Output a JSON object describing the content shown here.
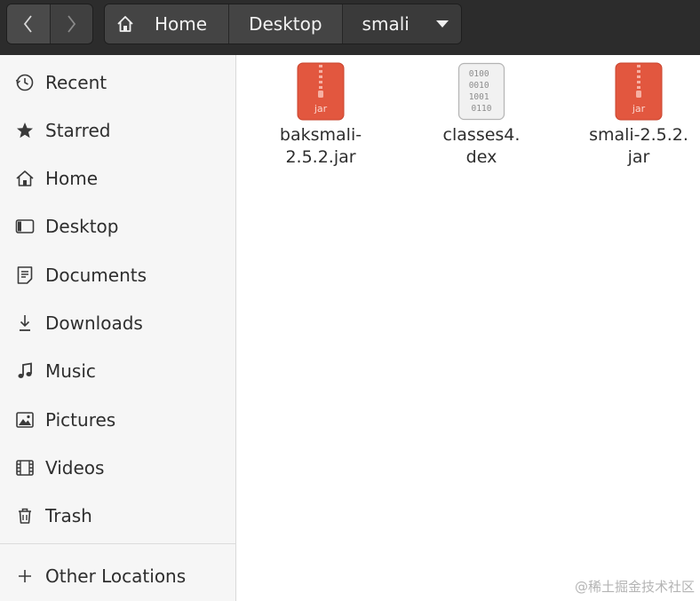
{
  "toolbar": {
    "back_icon": "chevron-left-icon",
    "forward_icon": "chevron-right-icon"
  },
  "pathbar": {
    "home_icon": "home-icon",
    "crumbs": [
      "Home",
      "Desktop",
      "smali"
    ],
    "menu_icon": "caret-down-icon"
  },
  "sidebar": {
    "items": [
      {
        "label": "Recent",
        "icon": "clock-icon"
      },
      {
        "label": "Starred",
        "icon": "star-icon"
      },
      {
        "label": "Home",
        "icon": "home-icon"
      },
      {
        "label": "Desktop",
        "icon": "desktop-icon"
      },
      {
        "label": "Documents",
        "icon": "document-icon"
      },
      {
        "label": "Downloads",
        "icon": "download-icon"
      },
      {
        "label": "Music",
        "icon": "music-icon"
      },
      {
        "label": "Pictures",
        "icon": "picture-icon"
      },
      {
        "label": "Videos",
        "icon": "video-icon"
      },
      {
        "label": "Trash",
        "icon": "trash-icon"
      }
    ],
    "other": {
      "label": "Other Locations",
      "icon": "plus-icon"
    }
  },
  "files": [
    {
      "name": "baksmali-\n2.5.2.jar",
      "icon": "jar-archive-icon",
      "icon_text": "jar"
    },
    {
      "name": "classes4.\ndex",
      "icon": "binary-file-icon",
      "icon_text": "0100\n0010\n1001\n0110"
    },
    {
      "name": "smali-2.5.2.\njar",
      "icon": "jar-archive-icon",
      "icon_text": "jar"
    }
  ],
  "colors": {
    "header_bg": "#2c2c2c",
    "sidebar_bg": "#f6f6f6",
    "jar_icon": "#e2573f"
  },
  "watermark": "@稀土掘金技术社区"
}
